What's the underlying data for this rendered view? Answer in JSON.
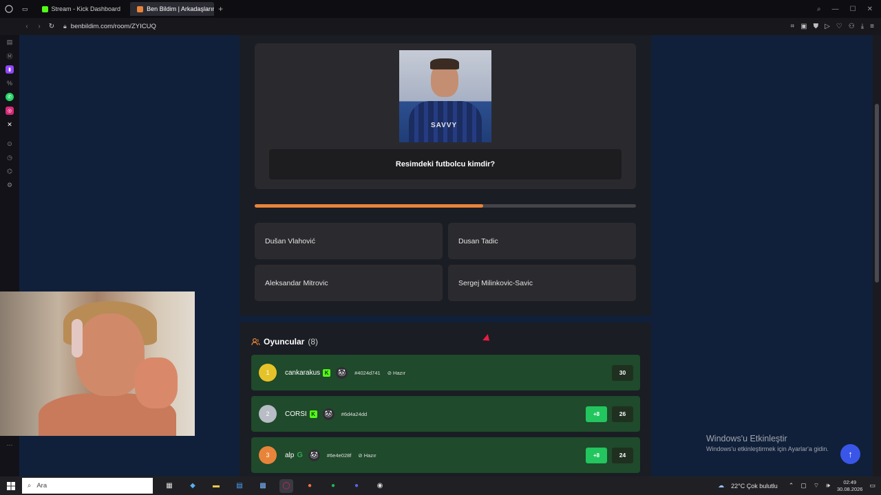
{
  "browser": {
    "tabs": [
      {
        "label": "Stream - Kick Dashboard",
        "active": false,
        "favicon_color": "#53fc18"
      },
      {
        "label": "Ben Bildim | Arkadaşlarınla",
        "active": true,
        "favicon_color": "#e8843a"
      }
    ],
    "new_tab_icon": "+",
    "url": "benbildim.com/room/ZYICUQ"
  },
  "game": {
    "question": "Resimdeki futbolcu kimdir?",
    "photo_sponsor": "SAVVY",
    "timer_progress": 0.6,
    "answers": [
      "Dušan Vlahović",
      "Dusan Tadic",
      "Aleksandar Mitrovic",
      "Sergej Milinkovic-Savic"
    ]
  },
  "players": {
    "title": "Oyuncular",
    "count": "(8)",
    "rows": [
      {
        "rank": "1",
        "name": "cankarakus",
        "platform": "K",
        "id": "#4024d741",
        "status": "⊘ Hazır",
        "plus": "",
        "score": "30",
        "rank_color": "#e6c229"
      },
      {
        "rank": "2",
        "name": "CORSI",
        "platform": "K",
        "id": "#6d4a24dd",
        "status": "",
        "plus": "+8",
        "score": "26",
        "rank_color": "#b8bcc4"
      },
      {
        "rank": "3",
        "name": "alp",
        "platform": "G",
        "id": "#6e4e028f",
        "status": "⊘ Hazır",
        "plus": "+8",
        "score": "24",
        "rank_color": "#e8843a"
      }
    ]
  },
  "watermark": {
    "title": "Windows'u Etkinleştir",
    "subtitle": "Windows'u etkinleştirmek için Ayarlar'a gidin."
  },
  "taskbar": {
    "search_placeholder": "Ara",
    "weather": "22°C  Çok bulutlu",
    "time": "02:49",
    "date": "30.08.2026"
  }
}
